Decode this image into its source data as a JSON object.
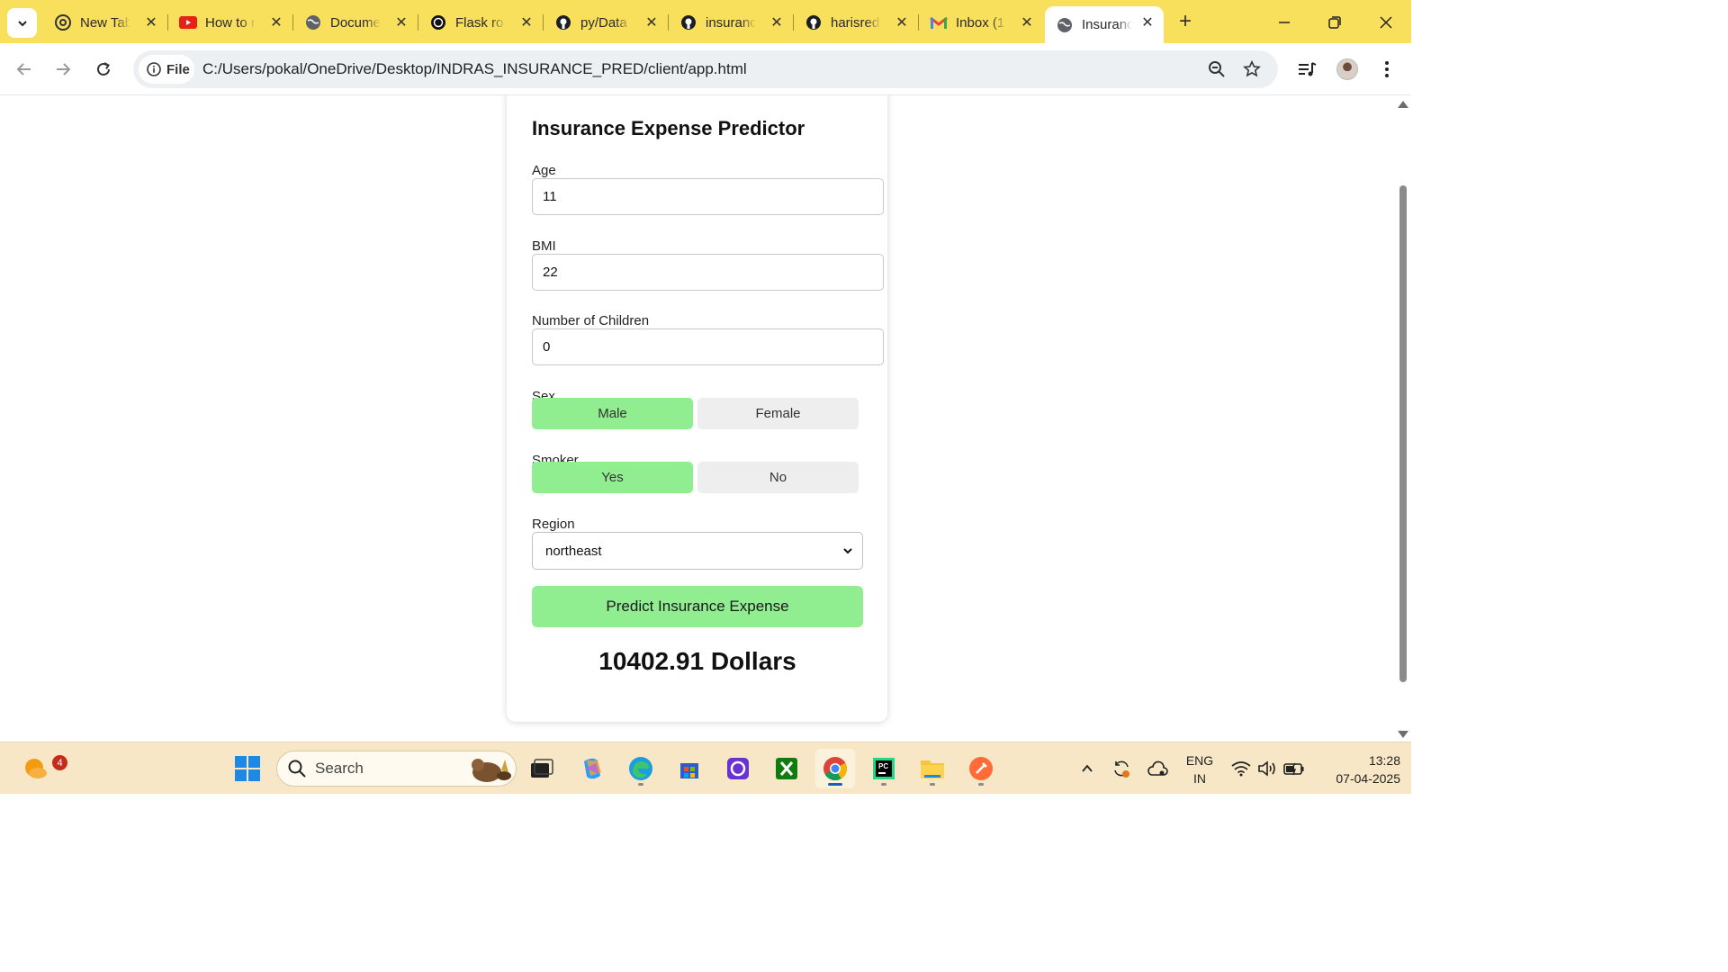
{
  "browser": {
    "tabs": [
      {
        "title": "New Tab",
        "favicon": "chrome-icon"
      },
      {
        "title": "How to r",
        "favicon": "youtube-icon"
      },
      {
        "title": "Docume",
        "favicon": "globe-icon"
      },
      {
        "title": "Flask ro",
        "favicon": "openai-icon"
      },
      {
        "title": "py/Data",
        "favicon": "github-icon"
      },
      {
        "title": "insuranc",
        "favicon": "github-icon"
      },
      {
        "title": "harisred",
        "favicon": "github-icon"
      },
      {
        "title": "Inbox (1",
        "favicon": "gmail-icon"
      },
      {
        "title": "Insuranc",
        "favicon": "globe-icon",
        "active": true
      }
    ],
    "address_chip": "File",
    "url": "C:/Users/pokal/OneDrive/Desktop/INDRAS_INSURANCE_PRED/client/app.html"
  },
  "app": {
    "title": "Insurance Expense Predictor",
    "age": {
      "label": "Age",
      "value": "11"
    },
    "bmi": {
      "label": "BMI",
      "value": "22"
    },
    "children": {
      "label": "Number of Children",
      "value": "0"
    },
    "sex": {
      "label": "Sex",
      "options": [
        "Male",
        "Female"
      ],
      "selected": "Male"
    },
    "smoker": {
      "label": "Smoker",
      "options": [
        "Yes",
        "No"
      ],
      "selected": "Yes"
    },
    "region": {
      "label": "Region",
      "value": "northeast"
    },
    "predict_button": "Predict Insurance Expense",
    "result": "10402.91 Dollars",
    "accent_color": "#90ee90"
  },
  "taskbar": {
    "weather_badge": "4",
    "search_label": "Search",
    "language": [
      "ENG",
      "IN"
    ],
    "time": "13:28",
    "date": "07-04-2025"
  }
}
